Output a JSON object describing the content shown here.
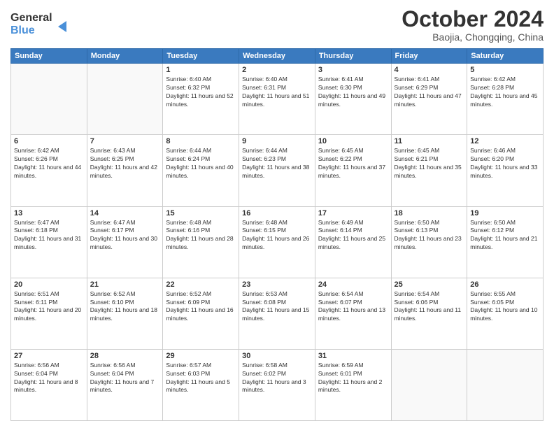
{
  "header": {
    "logo_line1": "General",
    "logo_line2": "Blue",
    "month": "October 2024",
    "location": "Baojia, Chongqing, China"
  },
  "weekdays": [
    "Sunday",
    "Monday",
    "Tuesday",
    "Wednesday",
    "Thursday",
    "Friday",
    "Saturday"
  ],
  "weeks": [
    [
      {
        "day": "",
        "info": ""
      },
      {
        "day": "",
        "info": ""
      },
      {
        "day": "1",
        "info": "Sunrise: 6:40 AM\nSunset: 6:32 PM\nDaylight: 11 hours and 52 minutes."
      },
      {
        "day": "2",
        "info": "Sunrise: 6:40 AM\nSunset: 6:31 PM\nDaylight: 11 hours and 51 minutes."
      },
      {
        "day": "3",
        "info": "Sunrise: 6:41 AM\nSunset: 6:30 PM\nDaylight: 11 hours and 49 minutes."
      },
      {
        "day": "4",
        "info": "Sunrise: 6:41 AM\nSunset: 6:29 PM\nDaylight: 11 hours and 47 minutes."
      },
      {
        "day": "5",
        "info": "Sunrise: 6:42 AM\nSunset: 6:28 PM\nDaylight: 11 hours and 45 minutes."
      }
    ],
    [
      {
        "day": "6",
        "info": "Sunrise: 6:42 AM\nSunset: 6:26 PM\nDaylight: 11 hours and 44 minutes."
      },
      {
        "day": "7",
        "info": "Sunrise: 6:43 AM\nSunset: 6:25 PM\nDaylight: 11 hours and 42 minutes."
      },
      {
        "day": "8",
        "info": "Sunrise: 6:44 AM\nSunset: 6:24 PM\nDaylight: 11 hours and 40 minutes."
      },
      {
        "day": "9",
        "info": "Sunrise: 6:44 AM\nSunset: 6:23 PM\nDaylight: 11 hours and 38 minutes."
      },
      {
        "day": "10",
        "info": "Sunrise: 6:45 AM\nSunset: 6:22 PM\nDaylight: 11 hours and 37 minutes."
      },
      {
        "day": "11",
        "info": "Sunrise: 6:45 AM\nSunset: 6:21 PM\nDaylight: 11 hours and 35 minutes."
      },
      {
        "day": "12",
        "info": "Sunrise: 6:46 AM\nSunset: 6:20 PM\nDaylight: 11 hours and 33 minutes."
      }
    ],
    [
      {
        "day": "13",
        "info": "Sunrise: 6:47 AM\nSunset: 6:18 PM\nDaylight: 11 hours and 31 minutes."
      },
      {
        "day": "14",
        "info": "Sunrise: 6:47 AM\nSunset: 6:17 PM\nDaylight: 11 hours and 30 minutes."
      },
      {
        "day": "15",
        "info": "Sunrise: 6:48 AM\nSunset: 6:16 PM\nDaylight: 11 hours and 28 minutes."
      },
      {
        "day": "16",
        "info": "Sunrise: 6:48 AM\nSunset: 6:15 PM\nDaylight: 11 hours and 26 minutes."
      },
      {
        "day": "17",
        "info": "Sunrise: 6:49 AM\nSunset: 6:14 PM\nDaylight: 11 hours and 25 minutes."
      },
      {
        "day": "18",
        "info": "Sunrise: 6:50 AM\nSunset: 6:13 PM\nDaylight: 11 hours and 23 minutes."
      },
      {
        "day": "19",
        "info": "Sunrise: 6:50 AM\nSunset: 6:12 PM\nDaylight: 11 hours and 21 minutes."
      }
    ],
    [
      {
        "day": "20",
        "info": "Sunrise: 6:51 AM\nSunset: 6:11 PM\nDaylight: 11 hours and 20 minutes."
      },
      {
        "day": "21",
        "info": "Sunrise: 6:52 AM\nSunset: 6:10 PM\nDaylight: 11 hours and 18 minutes."
      },
      {
        "day": "22",
        "info": "Sunrise: 6:52 AM\nSunset: 6:09 PM\nDaylight: 11 hours and 16 minutes."
      },
      {
        "day": "23",
        "info": "Sunrise: 6:53 AM\nSunset: 6:08 PM\nDaylight: 11 hours and 15 minutes."
      },
      {
        "day": "24",
        "info": "Sunrise: 6:54 AM\nSunset: 6:07 PM\nDaylight: 11 hours and 13 minutes."
      },
      {
        "day": "25",
        "info": "Sunrise: 6:54 AM\nSunset: 6:06 PM\nDaylight: 11 hours and 11 minutes."
      },
      {
        "day": "26",
        "info": "Sunrise: 6:55 AM\nSunset: 6:05 PM\nDaylight: 11 hours and 10 minutes."
      }
    ],
    [
      {
        "day": "27",
        "info": "Sunrise: 6:56 AM\nSunset: 6:04 PM\nDaylight: 11 hours and 8 minutes."
      },
      {
        "day": "28",
        "info": "Sunrise: 6:56 AM\nSunset: 6:04 PM\nDaylight: 11 hours and 7 minutes."
      },
      {
        "day": "29",
        "info": "Sunrise: 6:57 AM\nSunset: 6:03 PM\nDaylight: 11 hours and 5 minutes."
      },
      {
        "day": "30",
        "info": "Sunrise: 6:58 AM\nSunset: 6:02 PM\nDaylight: 11 hours and 3 minutes."
      },
      {
        "day": "31",
        "info": "Sunrise: 6:59 AM\nSunset: 6:01 PM\nDaylight: 11 hours and 2 minutes."
      },
      {
        "day": "",
        "info": ""
      },
      {
        "day": "",
        "info": ""
      }
    ]
  ]
}
